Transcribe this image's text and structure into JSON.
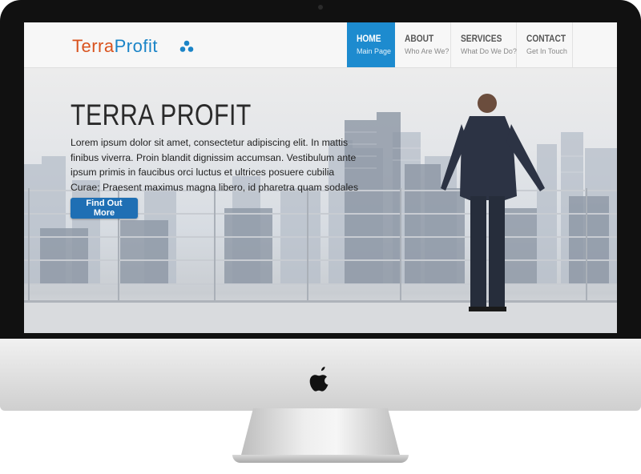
{
  "logo": {
    "part1": "Terra",
    "part2": "Profit"
  },
  "nav": [
    {
      "title": "HOME",
      "subtitle": "Main Page"
    },
    {
      "title": "ABOUT",
      "subtitle": "Who Are We?"
    },
    {
      "title": "SERVICES",
      "subtitle": "What Do We Do?"
    },
    {
      "title": "CONTACT",
      "subtitle": "Get In Touch"
    }
  ],
  "hero": {
    "title": "TERRA PROFIT",
    "text": "Lorem ipsum dolor sit amet, consectetur adipiscing elit. In mattis finibus viverra. Proin blandit dignissim accumsan. Vestibulum ante ipsum primis in faucibus orci luctus et ultrices posuere cubilia Curae; Praesent maximus magna libero, id pharetra quam sodales eget.",
    "button": "Find Out More"
  },
  "colors": {
    "accent": "#1d8bcf",
    "logo_orange": "#d9531e",
    "logo_blue": "#1a84c7",
    "button": "#1f6fb4"
  },
  "icons": {
    "device_brand": "apple-logo-icon"
  }
}
